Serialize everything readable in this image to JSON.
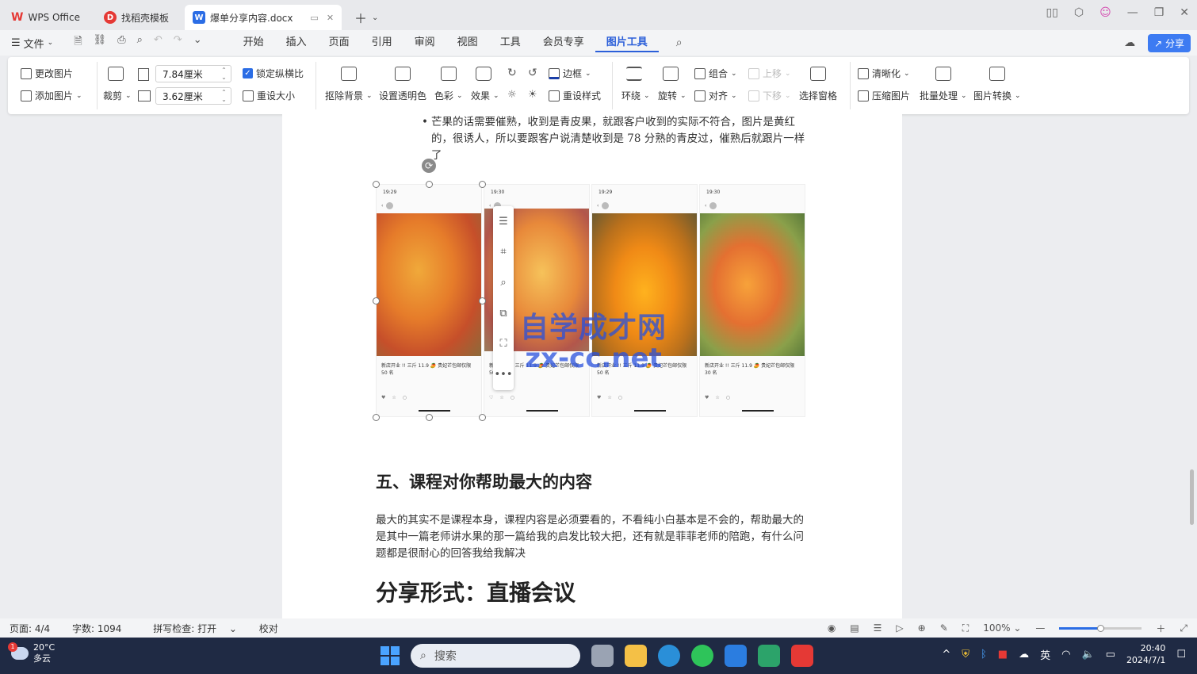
{
  "tabs": [
    {
      "label": "WPS Office"
    },
    {
      "label": "找稻壳模板"
    },
    {
      "label": "爆单分享内容.docx"
    }
  ],
  "menubar": {
    "file": "文件",
    "menus": [
      "开始",
      "插入",
      "页面",
      "引用",
      "审阅",
      "视图",
      "工具",
      "会员专享",
      "图片工具"
    ],
    "active_menu": "图片工具",
    "share": "分享"
  },
  "ribbon": {
    "change_image": "更改图片",
    "add_image": "添加图片",
    "crop": "裁剪",
    "width": "7.84厘米",
    "height": "3.62厘米",
    "lock_ratio": "锁定纵横比",
    "reset_size": "重设大小",
    "remove_bg": "抠除背景",
    "set_transparent": "设置透明色",
    "color": "色彩",
    "effects": "效果",
    "border": "边框",
    "reset_style": "重设样式",
    "wrap": "环绕",
    "rotate": "旋转",
    "group": "组合",
    "align": "对齐",
    "bring_forward": "上移",
    "send_backward": "下移",
    "selection_pane": "选择窗格",
    "sharpen": "清晰化",
    "compress": "压缩图片",
    "batch": "批量处理",
    "convert": "图片转换"
  },
  "document": {
    "bullet_text": "芒果的话需要催熟，收到是青皮果，就跟客户收到的实际不符合，图片是黄红的，很诱人，所以要跟客户说清楚收到是 78 分熟的青皮过，催熟后就跟片一样了",
    "section_heading": "五、课程对你帮助最大的内容",
    "paragraph": "最大的其实不是课程本身，课程内容是必须要看的，不看纯小白基本是不会的，帮助最大的是其中一篇老师讲水果的那一篇给我的启发比较大把，还有就是菲菲老师的陪跑，有什么问题都是很耐心的回答我给我解决",
    "big_heading": "分享形式：直播会议",
    "watermark_line1": "自学成才网",
    "watermark_line2": "zx-cc.net",
    "screenshots": [
      {
        "time": "19:29",
        "caption": "新店开业 !! 三斤 11.9 🥭 贵妃芒包邮仅限 50 名"
      },
      {
        "time": "19:30",
        "caption": "新店开业 !! 三斤 11.9 🥭 贵妃芒包邮仅限 50 名"
      },
      {
        "time": "19:29",
        "caption": "新店开业 !! 三斤 11.9 🥭 贵妃芒包邮仅限 50 名"
      },
      {
        "time": "19:30",
        "caption": "新店开业 !! 三斤 11.9 🥭 贵妃芒包邮仅限 30 名"
      }
    ]
  },
  "statusbar": {
    "page": "页面: 4/4",
    "words": "字数: 1094",
    "spell": "拼写检查: 打开",
    "proof": "校对",
    "zoom": "100%",
    "zoom_fraction": 0.5
  },
  "taskbar": {
    "temp": "20°C",
    "weather": "多云",
    "badge": "1",
    "search": "搜索",
    "lang": "英",
    "time": "20:40",
    "date": "2024/7/1"
  },
  "colors": {
    "accent": "#2b5fd9",
    "share": "#3d7bf2",
    "watermark": "#2850dc",
    "taskbar": "#1f2a44"
  }
}
